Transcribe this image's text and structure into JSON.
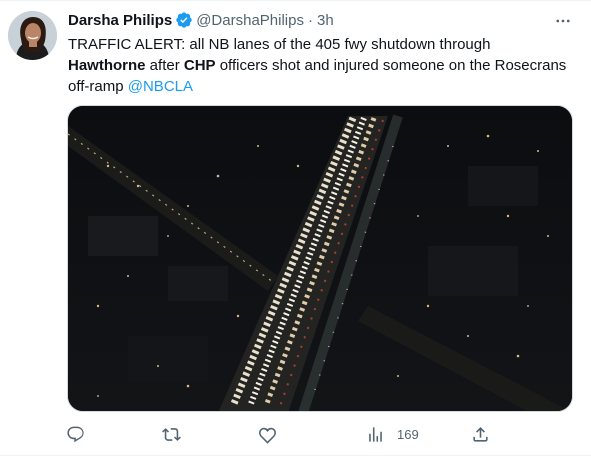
{
  "tweet": {
    "display_name": "Darsha Philips",
    "handle": "@DarshaPhilips",
    "separator": "·",
    "time": "3h",
    "text_parts": {
      "p1": "TRAFFIC ALERT: all NB lanes of the 405 fwy shutdown through ",
      "p2": "Hawthorne",
      "p3": " after ",
      "p4": "CHP",
      "p5": " officers shot and injured someone on the Rosecrans off-ramp ",
      "mention": "@NBCLA"
    },
    "media_alt": "Aerial night view of backed-up traffic on the 405 freeway",
    "actions": {
      "reply_count": "",
      "retweet_count": "",
      "like_count": "",
      "views_count": "169"
    }
  },
  "colors": {
    "accent": "#1d9bf0",
    "text": "#0f1419",
    "secondary": "#536471",
    "border": "#cfd9de"
  },
  "icons": {
    "verified": "verified-badge-icon",
    "more": "more-horizontal-icon",
    "reply": "reply-icon",
    "retweet": "retweet-icon",
    "like": "heart-icon",
    "views": "views-bar-chart-icon",
    "share": "share-icon"
  }
}
